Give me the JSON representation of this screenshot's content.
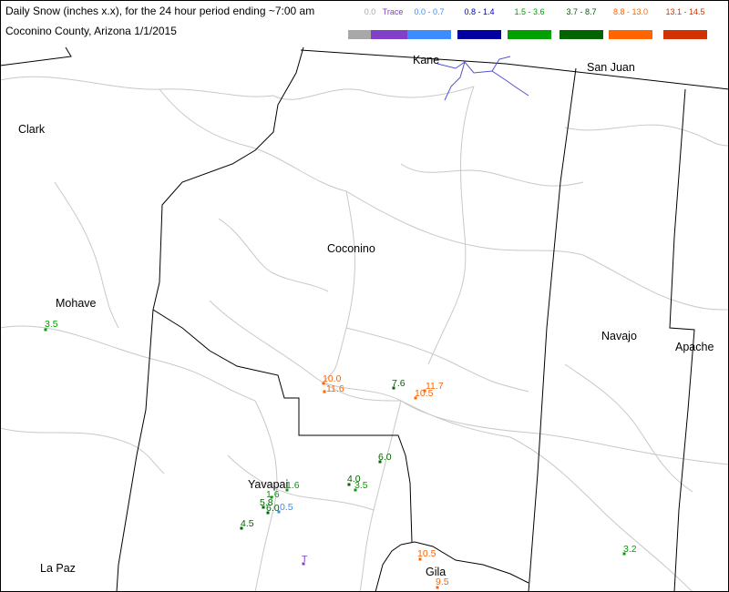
{
  "header": {
    "title_line1": "Daily Snow (inches  x.x),  for the 24 hour period ending ~7:00 am",
    "title_line2": "Coconino County, Arizona  1/1/2015"
  },
  "legend": [
    {
      "label": "0.0",
      "color": "#a8a8a8"
    },
    {
      "label": "Trace",
      "color": "#8040c8"
    },
    {
      "label": "0.0 - 0.7",
      "color": "#3c8cff"
    },
    {
      "label": "0.8 - 1.4",
      "color": "#0000a0"
    },
    {
      "label": "1.5 - 3.6",
      "color": "#00a000"
    },
    {
      "label": "3.7 - 8.7",
      "color": "#006400"
    },
    {
      "label": "8.8 - 13.0",
      "color": "#ff6400"
    },
    {
      "label": "13.1 - 14.5",
      "color": "#d23200"
    }
  ],
  "counties": [
    "Kane",
    "San Juan",
    "Clark",
    "Coconino",
    "Mohave",
    "Navajo",
    "Apache",
    "Yavapai",
    "La Paz",
    "Gila"
  ],
  "stations": [
    {
      "value": "3.5",
      "cls": 4
    },
    {
      "value": "10.0",
      "cls": 6
    },
    {
      "value": "11.6",
      "cls": 6
    },
    {
      "value": "7.6",
      "cls": 5
    },
    {
      "value": "11.7",
      "cls": 6
    },
    {
      "value": "10.5",
      "cls": 6
    },
    {
      "value": "6.0",
      "cls": 5
    },
    {
      "value": "4.0",
      "cls": 5
    },
    {
      "value": "3.5",
      "cls": 4
    },
    {
      "value": "1.6",
      "cls": 4
    },
    {
      "value": "1.6",
      "cls": 4
    },
    {
      "value": "5.8",
      "cls": 5
    },
    {
      "value": "6.0",
      "cls": 5
    },
    {
      "value": "0.5",
      "cls": 2
    },
    {
      "value": "4.5",
      "cls": 5
    },
    {
      "value": "T",
      "cls": 1
    },
    {
      "value": "10.5",
      "cls": 6
    },
    {
      "value": "9.5",
      "cls": 6
    },
    {
      "value": "3.2",
      "cls": 4
    }
  ]
}
